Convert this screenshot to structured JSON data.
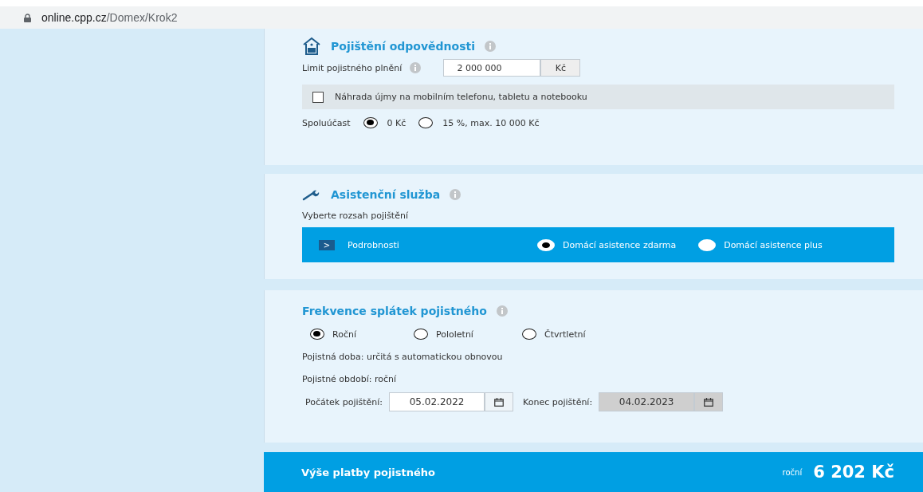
{
  "address_bar": {
    "host": "online.cpp.cz",
    "path": "/Domex/Krok2"
  },
  "liability": {
    "title": "Pojištění odpovědnosti",
    "limit_label": "Limit pojistného plnění",
    "limit_value": "2 000 000",
    "limit_unit": "Kč",
    "options": [
      {
        "label": "Náhrada újmy na mobilním telefonu, tabletu a notebooku",
        "checked": false
      }
    ],
    "deductible_label": "Spoluúčast",
    "deductible": [
      {
        "label": "0 Kč",
        "selected": true
      },
      {
        "label": "15 %, max. 10 000 Kč",
        "selected": false
      }
    ]
  },
  "assistance": {
    "title": "Asistenční služba",
    "prompt": "Vyberte rozsah pojištění",
    "details_icon": ">",
    "details_label": "Podrobnosti",
    "choices": [
      {
        "label": "Domácí asistence zdarma",
        "selected": true
      },
      {
        "label": "Domácí asistence plus",
        "selected": false
      }
    ]
  },
  "frequency": {
    "title": "Frekvence splátek pojistného",
    "choices": [
      {
        "label": "Roční",
        "selected": true
      },
      {
        "label": "Pololetní",
        "selected": false
      },
      {
        "label": "Čtvrtletní",
        "selected": false
      }
    ],
    "notes": [
      "Pojistná doba: určitá s automatickou obnovou",
      "Pojistné období: roční"
    ],
    "dates": [
      {
        "label": "Počátek pojištění:",
        "value": "05.02.2022",
        "disabled": false
      },
      {
        "label": "Konec pojištění:",
        "value": "04.02.2023",
        "disabled": true
      }
    ]
  },
  "total": {
    "label": "Výše platby pojistného",
    "period": "roční",
    "amount": "6 202 Kč"
  }
}
